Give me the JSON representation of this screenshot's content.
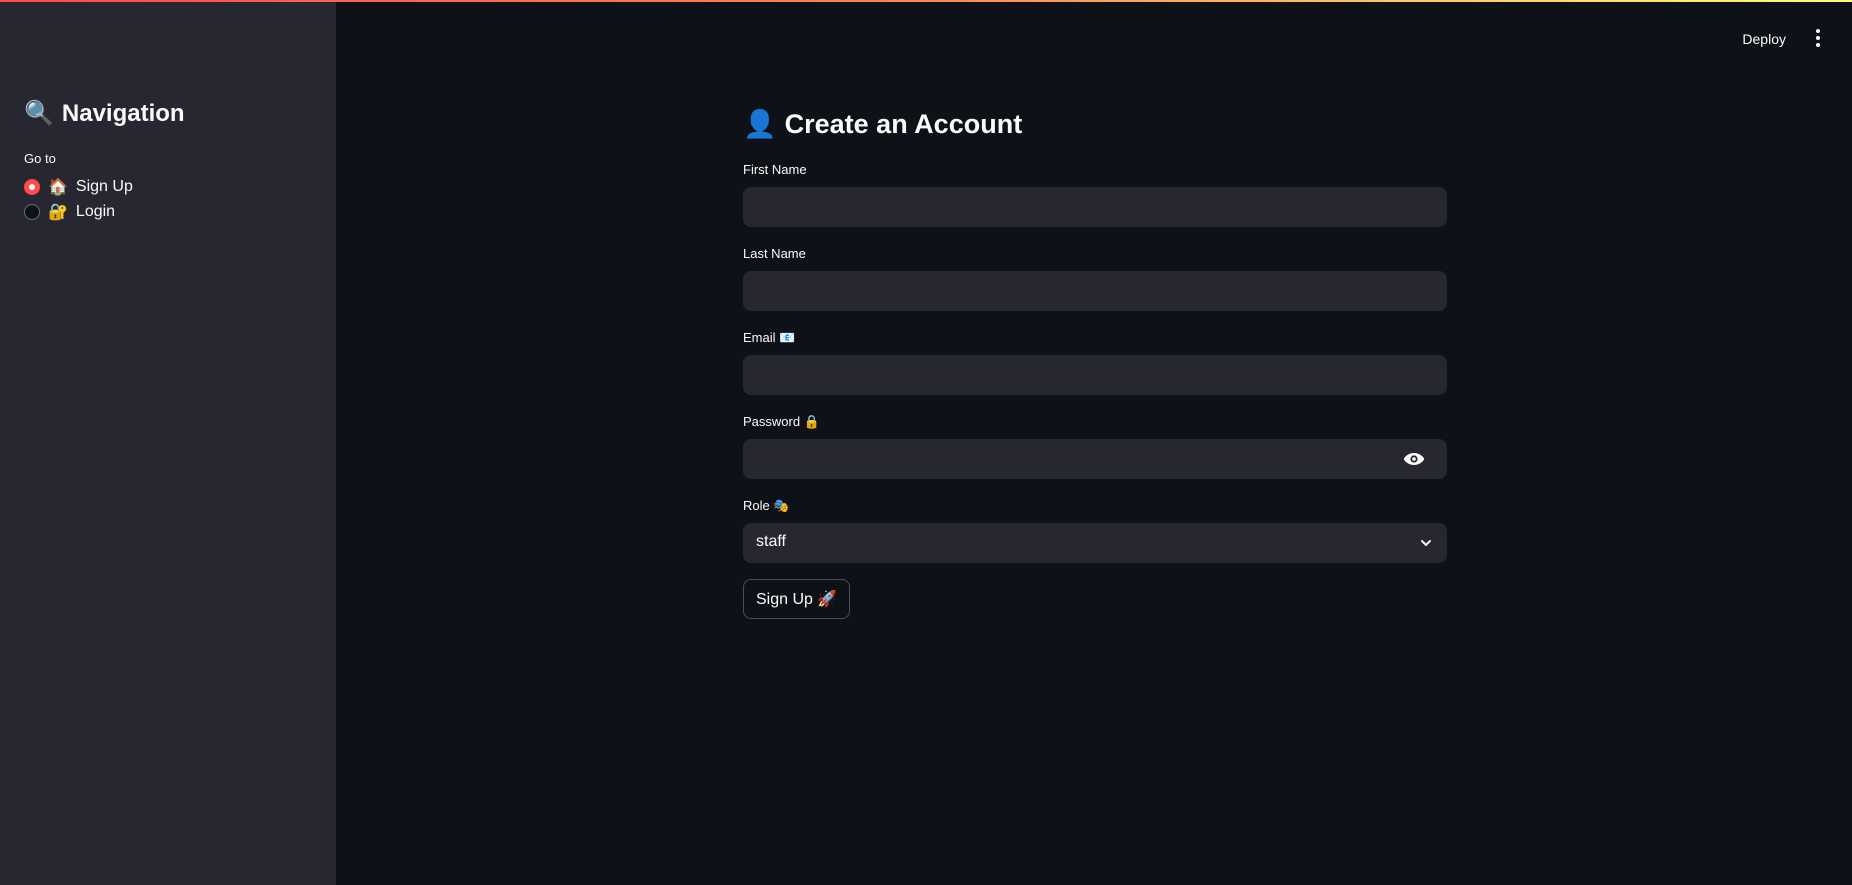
{
  "colors": {
    "accent": "#ff4b4b",
    "sidebar_bg": "#262730",
    "main_bg": "#0e1117",
    "input_bg": "#262730",
    "text": "#fafafa"
  },
  "header": {
    "deploy_label": "Deploy",
    "menu_icon": "kebab-menu-icon"
  },
  "sidebar": {
    "title_emoji": "🔍",
    "title": "Navigation",
    "radio_label": "Go to",
    "options": [
      {
        "emoji": "🏠",
        "label": "Sign Up",
        "selected": true
      },
      {
        "emoji": "🔐",
        "label": "Login",
        "selected": false
      }
    ]
  },
  "main": {
    "title_emoji": "👤",
    "title": "Create an Account",
    "fields": {
      "first_name": {
        "label": "First Name",
        "value": ""
      },
      "last_name": {
        "label": "Last Name",
        "value": ""
      },
      "email": {
        "label": "Email 📧",
        "value": ""
      },
      "password": {
        "label": "Password 🔒",
        "value": "",
        "icon": "eye-icon"
      },
      "role": {
        "label": "Role 🎭",
        "value": "staff",
        "icon": "chevron-down-icon"
      }
    },
    "submit_label": "Sign Up 🚀"
  }
}
